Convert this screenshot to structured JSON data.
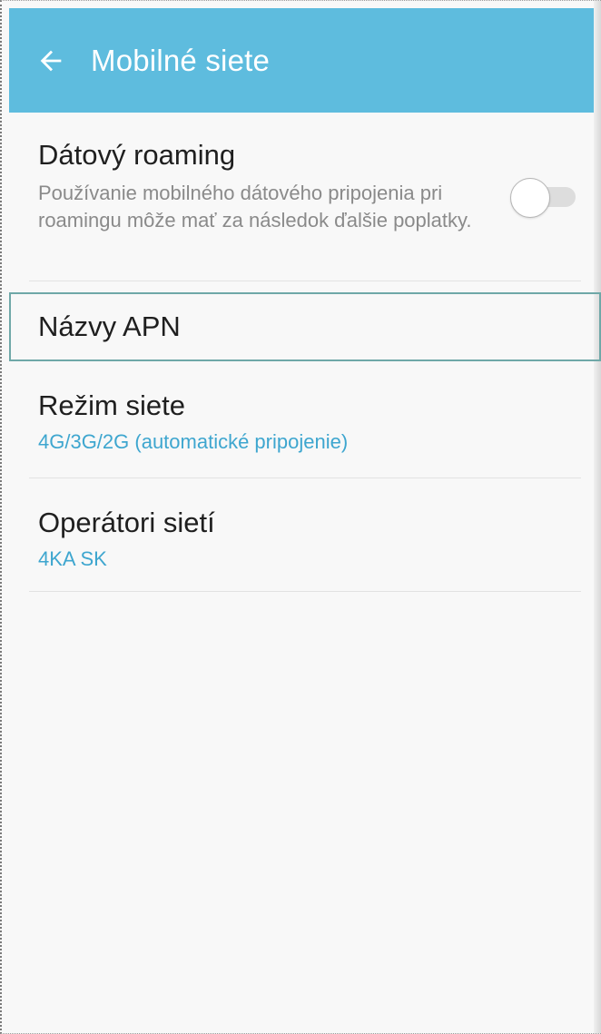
{
  "header": {
    "title": "Mobilné siete",
    "back_icon": "arrow-left-icon"
  },
  "settings": {
    "data_roaming": {
      "title": "Dátový roaming",
      "description": "Používanie mobilného dátového pripojenia pri roamingu môže mať za následok ďalšie poplatky.",
      "toggle_state": "off"
    },
    "apn": {
      "title": "Názvy APN"
    },
    "network_mode": {
      "title": "Režim siete",
      "value": "4G/3G/2G (automatické pripojenie)"
    },
    "network_operators": {
      "title": "Operátori sietí",
      "value": "4KA SK"
    }
  },
  "colors": {
    "appbar": "#5ebcde",
    "accent_value": "#3ea6cf",
    "focus_border": "#6fa8a8"
  }
}
